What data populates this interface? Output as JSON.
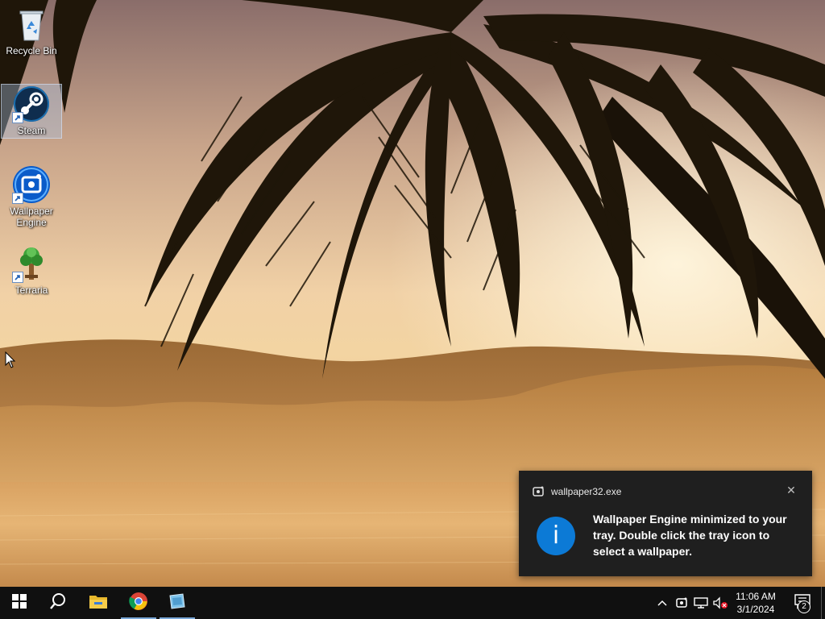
{
  "desktop": {
    "icons": [
      {
        "label": "Recycle Bin",
        "icon": "recycle-bin-icon"
      },
      {
        "label": "Steam",
        "icon": "steam-icon",
        "selected": true
      },
      {
        "label": "Wallpaper Engine",
        "icon": "wallpaper-engine-icon"
      },
      {
        "label": "Terraria",
        "icon": "terraria-icon"
      }
    ]
  },
  "notification": {
    "app_name": "wallpaper32.exe",
    "app_icon": "wallpaper-engine-icon",
    "message": "Wallpaper Engine minimized to your tray. Double click the tray icon to select a wallpaper.",
    "info_glyph": "i",
    "close_glyph": "✕",
    "accent_color": "#0c7ad6"
  },
  "taskbar": {
    "start_icon": "windows-start-icon",
    "search_icon": "search-icon",
    "pinned": [
      {
        "name": "File Explorer",
        "icon": "file-explorer-icon"
      },
      {
        "name": "Google Chrome",
        "icon": "chrome-icon"
      },
      {
        "name": "Wallpaper Engine",
        "icon": "wallpaper-engine-taskbar-icon"
      }
    ],
    "tray": {
      "icons": [
        "chevron-up-icon",
        "wallpaper-engine-tray-icon",
        "network-icon",
        "volume-muted-icon"
      ]
    },
    "clock": {
      "time": "11:06 AM",
      "date": "3/1/2024"
    },
    "notifications_count": "2"
  }
}
